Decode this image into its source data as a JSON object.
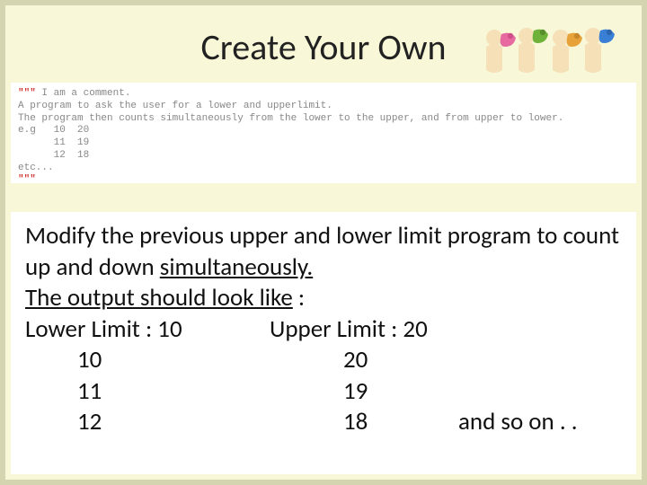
{
  "title": "Create Your Own",
  "code": {
    "l1_a": "\"\"\"",
    "l1_b": " I am a comment.",
    "l2": "A program to ask the user for a lower and upperlimit.",
    "l3": "The program then counts simultaneously from the lower to the upper, and from upper to lower.",
    "l4": "e.g   10  20",
    "l5": "      11  19",
    "l6": "      12  18",
    "l7": "etc...",
    "l8": "\"\"\""
  },
  "body": {
    "p1a": "Modify the previous upper and lower limit program to count up and down ",
    "p1b_u": "simultaneously.",
    "p2a_u": "The output should look like",
    "p2b": " :",
    "lower_label": "Lower Limit : 10",
    "upper_label": "Upper Limit : 20",
    "rows": [
      {
        "a": "10",
        "b": "20",
        "suffix": ""
      },
      {
        "a": "11",
        "b": "19",
        "suffix": ""
      },
      {
        "a": "12",
        "b": "18",
        "suffix": "and so on . ."
      }
    ]
  }
}
